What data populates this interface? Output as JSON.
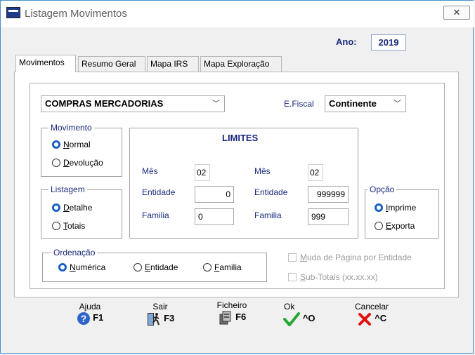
{
  "window": {
    "title": "Listagem Movimentos",
    "close_glyph": "✕"
  },
  "ano": {
    "label": "Ano:",
    "value": "2019"
  },
  "tabs": [
    {
      "label": "Movimentos",
      "active": true
    },
    {
      "label": "Resumo Geral",
      "active": false
    },
    {
      "label": "Mapa IRS",
      "active": false
    },
    {
      "label": "Mapa Exploração",
      "active": false
    }
  ],
  "tipo": {
    "value": "COMPRAS MERCADORIAS"
  },
  "efiscal": {
    "label": "E.Fiscal",
    "value": "Continente"
  },
  "movimento": {
    "legend": "Movimento",
    "options": [
      {
        "label_first": "N",
        "label_rest": "ormal",
        "selected": true
      },
      {
        "label_first": "D",
        "label_rest": "evolução",
        "selected": false
      }
    ]
  },
  "listagem": {
    "legend": "Listagem",
    "options": [
      {
        "label_first": "D",
        "label_rest": "etalhe",
        "selected": true
      },
      {
        "label_first": "T",
        "label_rest": "otais",
        "selected": false
      }
    ]
  },
  "limites": {
    "title": "LIMITES",
    "from": {
      "mes_label": "Mês",
      "mes": "02",
      "entidade_label": "Entidade",
      "entidade": "0",
      "familia_label": "Familia",
      "familia": "0"
    },
    "to": {
      "mes_label": "Mês",
      "mes": "02",
      "entidade_label": "Entidade",
      "entidade": "999999",
      "familia_label": "Familia",
      "familia": "999"
    }
  },
  "opcao": {
    "legend": "Opção",
    "options": [
      {
        "label_first": "I",
        "label_rest": "mprime",
        "selected": true
      },
      {
        "label_first": "E",
        "label_rest": "xporta",
        "selected": false
      }
    ]
  },
  "ordenacao": {
    "legend": "Ordenação",
    "options": [
      {
        "label_first": "N",
        "label_rest": "umérica",
        "selected": true
      },
      {
        "label_first": "E",
        "label_rest": "ntidade",
        "selected": false
      },
      {
        "label_first": "F",
        "label_rest": "amilia",
        "selected": false
      }
    ]
  },
  "checks": [
    {
      "label_first": "M",
      "label_rest": "uda de Página por Entidade",
      "checked": false
    },
    {
      "label_first": "S",
      "label_rest": "ub-Totais (xx.xx.xx)",
      "checked": false
    }
  ],
  "buttons": [
    {
      "caption": "Ajuda",
      "key": "F1",
      "icon": "help-icon"
    },
    {
      "caption": "Sair",
      "key": "F3",
      "icon": "exit-icon"
    },
    {
      "caption": "Ficheiro",
      "key": "F6",
      "icon": "file-icon"
    },
    {
      "caption": "Ok",
      "key": "^O",
      "icon": "checkmark-icon"
    },
    {
      "caption": "Cancelar",
      "key": "^C",
      "icon": "cancel-x-icon"
    }
  ]
}
